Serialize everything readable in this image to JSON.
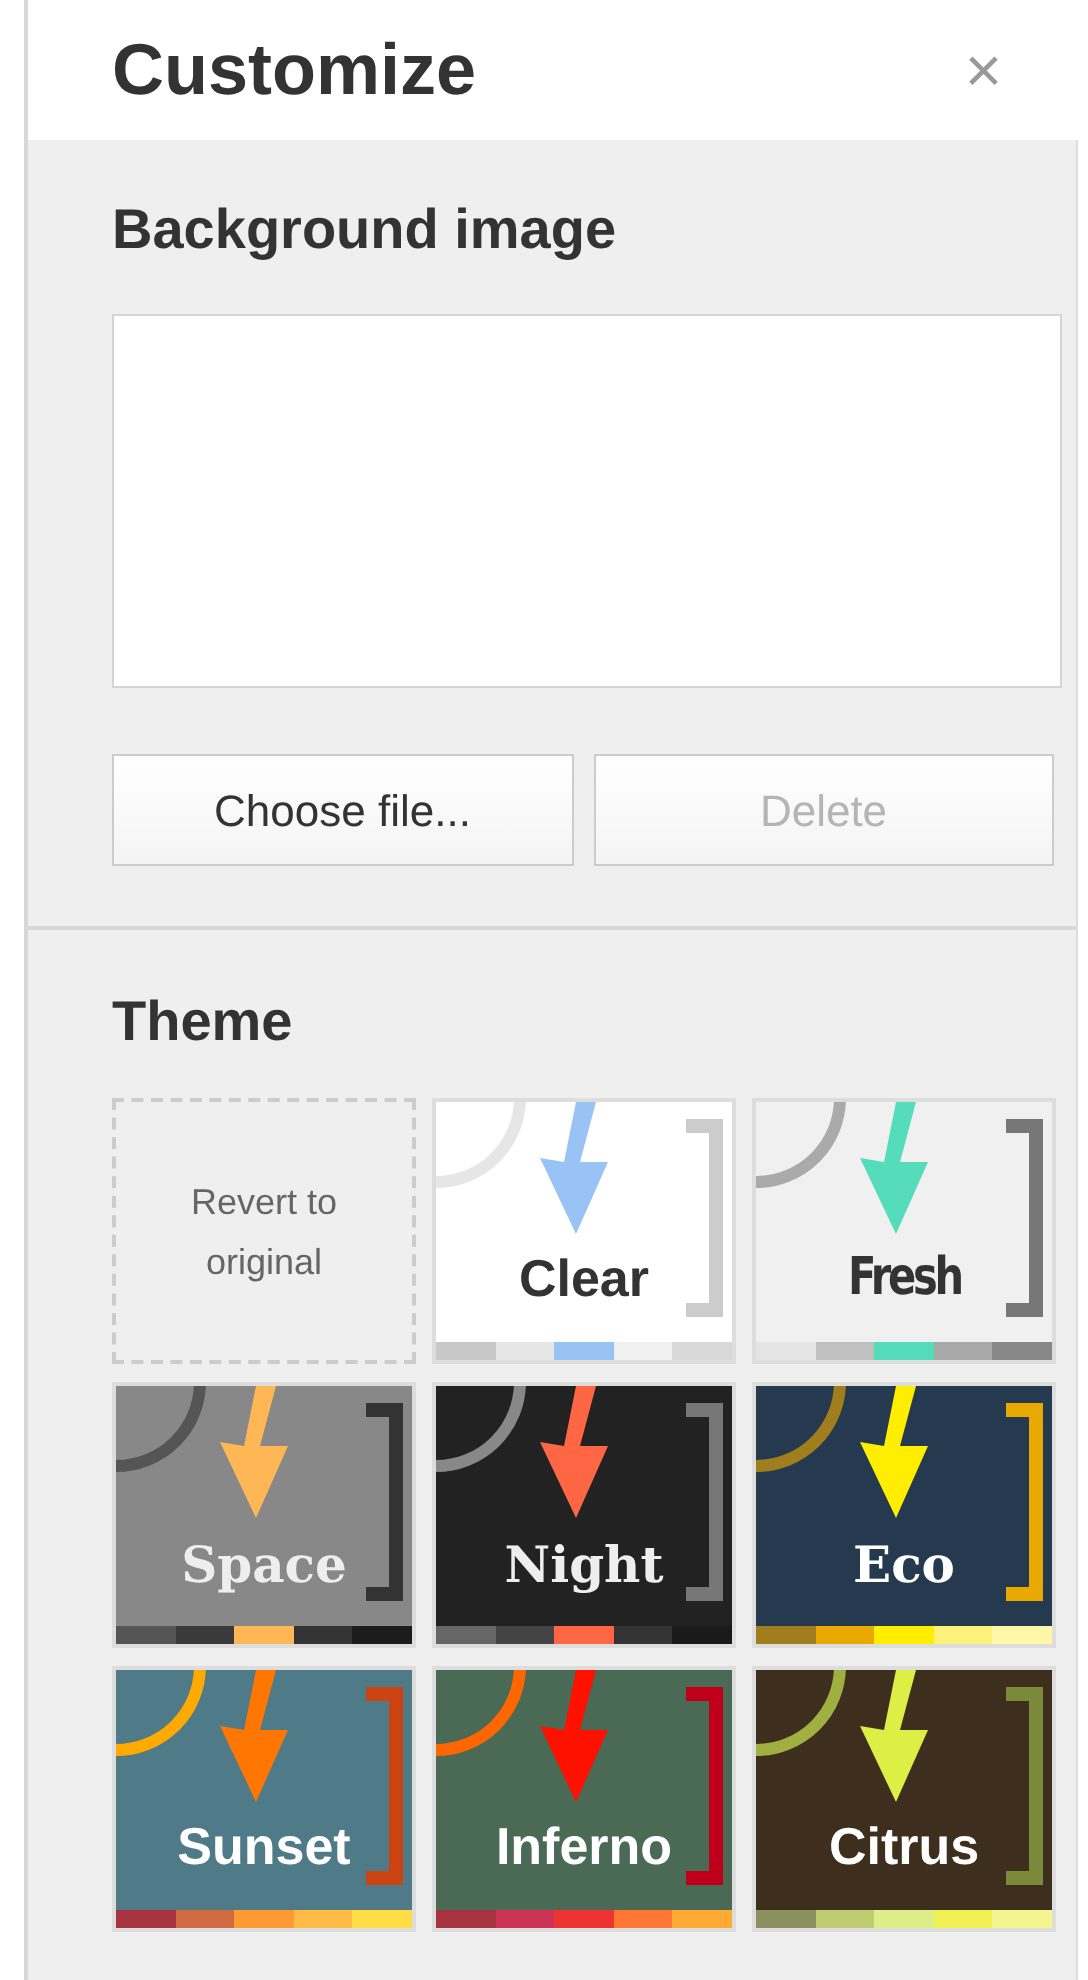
{
  "header": {
    "title": "Customize",
    "close": "×"
  },
  "background_image": {
    "heading": "Background image",
    "buttons": [
      {
        "label": "Choose file...",
        "disabled": false
      },
      {
        "label": "Delete",
        "disabled": true
      }
    ]
  },
  "theme": {
    "heading": "Theme",
    "tiles": [
      {
        "kind": "revert",
        "label": "Revert to original"
      },
      {
        "kind": "theme",
        "color": "#ffffff",
        "name": {
          "kind": "sans",
          "text": "Clear",
          "color": "#333333"
        },
        "parts": [
          {
            "kind": "arc",
            "color": "#e6e6e6"
          },
          {
            "kind": "arrow",
            "color": "#99c2f5"
          },
          {
            "kind": "bracket",
            "color": "#cccccc"
          }
        ],
        "swatches": [
          {
            "color": "#c8c8c8"
          },
          {
            "color": "#e6e6e6"
          },
          {
            "color": "#99c2f5"
          },
          {
            "color": "#f0f0f0"
          },
          {
            "color": "#d8d8d8"
          }
        ]
      },
      {
        "kind": "theme",
        "color": "#f0f0f0",
        "name": {
          "kind": "condensed",
          "text": "Fresh",
          "color": "#333333"
        },
        "parts": [
          {
            "kind": "arc",
            "color": "#aaaaaa"
          },
          {
            "kind": "arrow",
            "color": "#55ddbb"
          },
          {
            "kind": "bracket",
            "color": "#777777"
          }
        ],
        "swatches": [
          {
            "color": "#e4e4e4"
          },
          {
            "color": "#c0c0c0"
          },
          {
            "color": "#55ddbb"
          },
          {
            "color": "#a8a8a8"
          },
          {
            "color": "#888888"
          }
        ]
      },
      {
        "kind": "theme",
        "color": "#888888",
        "name": {
          "kind": "serif",
          "text": "Space",
          "color": "#eeeeee"
        },
        "parts": [
          {
            "kind": "arc",
            "color": "#555555"
          },
          {
            "kind": "arrow",
            "color": "#ffb755"
          },
          {
            "kind": "bracket",
            "color": "#333333"
          }
        ],
        "swatches": [
          {
            "color": "#555555"
          },
          {
            "color": "#3a3a3a"
          },
          {
            "color": "#ffb755"
          },
          {
            "color": "#333333"
          },
          {
            "color": "#1c1c1c"
          }
        ]
      },
      {
        "kind": "theme",
        "color": "#222222",
        "name": {
          "kind": "serif",
          "text": "Night",
          "color": "#eeeeee"
        },
        "parts": [
          {
            "kind": "arc",
            "color": "#888888"
          },
          {
            "kind": "arrow",
            "color": "#ff6644"
          },
          {
            "kind": "bracket",
            "color": "#777777"
          }
        ],
        "swatches": [
          {
            "color": "#666666"
          },
          {
            "color": "#444444"
          },
          {
            "color": "#ff6644"
          },
          {
            "color": "#333333"
          },
          {
            "color": "#1a1a1a"
          }
        ]
      },
      {
        "kind": "theme",
        "color": "#263a4f",
        "name": {
          "kind": "serif",
          "text": "Eco",
          "color": "#ffffff"
        },
        "parts": [
          {
            "kind": "arc",
            "color": "#a07e1e"
          },
          {
            "kind": "arrow",
            "color": "#ffee00"
          },
          {
            "kind": "bracket",
            "color": "#e8aa00"
          }
        ],
        "swatches": [
          {
            "color": "#a07e1e"
          },
          {
            "color": "#e8aa00"
          },
          {
            "color": "#ffee00"
          },
          {
            "color": "#fff27a"
          },
          {
            "color": "#fff7a8"
          }
        ]
      },
      {
        "kind": "theme",
        "color": "#4f7a88",
        "name": {
          "kind": "sans",
          "text": "Sunset",
          "color": "#ffffff"
        },
        "parts": [
          {
            "kind": "arc",
            "color": "#ffaa00"
          },
          {
            "kind": "arrow",
            "color": "#ff7700"
          },
          {
            "kind": "bracket",
            "color": "#cc4411"
          }
        ],
        "swatches": [
          {
            "color": "#a83340"
          },
          {
            "color": "#d06a40"
          },
          {
            "color": "#ff9933"
          },
          {
            "color": "#ffbb44"
          },
          {
            "color": "#ffdd44"
          }
        ]
      },
      {
        "kind": "theme",
        "color": "#4a6a55",
        "name": {
          "kind": "sans",
          "text": "Inferno",
          "color": "#ffffff"
        },
        "parts": [
          {
            "kind": "arc",
            "color": "#ff6600"
          },
          {
            "kind": "arrow",
            "color": "#ff1100"
          },
          {
            "kind": "bracket",
            "color": "#c0001a"
          }
        ],
        "swatches": [
          {
            "color": "#a83340"
          },
          {
            "color": "#cc3355"
          },
          {
            "color": "#ee3333"
          },
          {
            "color": "#ff7733"
          },
          {
            "color": "#ffaa33"
          }
        ]
      },
      {
        "kind": "theme",
        "color": "#3e2e1e",
        "name": {
          "kind": "sans",
          "text": "Citrus",
          "color": "#ffffff"
        },
        "parts": [
          {
            "kind": "arc",
            "color": "#a0b040"
          },
          {
            "kind": "arrow",
            "color": "#ddee44"
          },
          {
            "kind": "bracket",
            "color": "#7a8a3a"
          }
        ],
        "swatches": [
          {
            "color": "#8a9060"
          },
          {
            "color": "#c0cc70"
          },
          {
            "color": "#ddee88"
          },
          {
            "color": "#f0f055"
          },
          {
            "color": "#f5f590"
          }
        ]
      }
    ]
  }
}
